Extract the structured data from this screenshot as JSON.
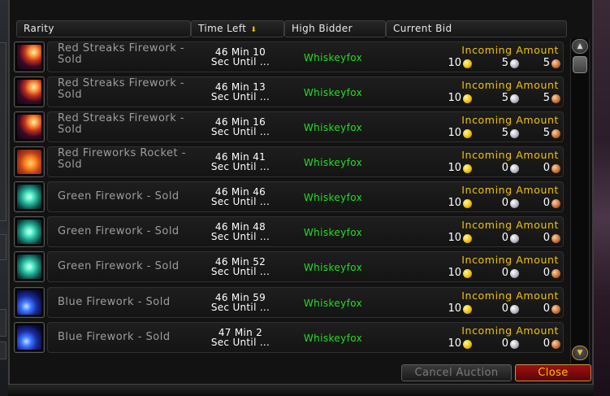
{
  "header": {
    "rarity": "Rarity",
    "time_left": "Time Left",
    "high_bidder": "High Bidder",
    "current_bid": "Current Bid"
  },
  "rows": [
    {
      "icon": "red-streaks-firework-icon",
      "name": "Red Streaks Firework - Sold",
      "time_left": "46 Min 10 Sec Until ...",
      "time_line1": "46 Min 10",
      "time_line2": "Sec Until ...",
      "bidder": "Whiskeyfox",
      "bid_label": "Incoming Amount",
      "gold": "10",
      "silver": "5",
      "copper": "5"
    },
    {
      "icon": "red-streaks-firework-icon",
      "name": "Red Streaks Firework - Sold",
      "time_left": "46 Min 13 Sec Until ...",
      "time_line1": "46 Min 13",
      "time_line2": "Sec Until ...",
      "bidder": "Whiskeyfox",
      "bid_label": "Incoming Amount",
      "gold": "10",
      "silver": "5",
      "copper": "5"
    },
    {
      "icon": "red-streaks-firework-icon",
      "name": "Red Streaks Firework - Sold",
      "time_left": "46 Min 16 Sec Until ...",
      "time_line1": "46 Min 16",
      "time_line2": "Sec Until ...",
      "bidder": "Whiskeyfox",
      "bid_label": "Incoming Amount",
      "gold": "10",
      "silver": "5",
      "copper": "5"
    },
    {
      "icon": "red-fireworks-rocket-icon",
      "name": "Red Fireworks Rocket - Sold",
      "time_left": "46 Min 41 Sec Until ...",
      "time_line1": "46 Min 41",
      "time_line2": "Sec Until ...",
      "bidder": "Whiskeyfox",
      "bid_label": "Incoming Amount",
      "gold": "10",
      "silver": "0",
      "copper": "0"
    },
    {
      "icon": "green-firework-icon",
      "name": "Green Firework - Sold",
      "time_left": "46 Min 46 Sec Until ...",
      "time_line1": "46 Min 46",
      "time_line2": "Sec Until ...",
      "bidder": "Whiskeyfox",
      "bid_label": "Incoming Amount",
      "gold": "10",
      "silver": "0",
      "copper": "0"
    },
    {
      "icon": "green-firework-icon",
      "name": "Green Firework - Sold",
      "time_left": "46 Min 48 Sec Until ...",
      "time_line1": "46 Min 48",
      "time_line2": "Sec Until ...",
      "bidder": "Whiskeyfox",
      "bid_label": "Incoming Amount",
      "gold": "10",
      "silver": "0",
      "copper": "0"
    },
    {
      "icon": "green-firework-icon",
      "name": "Green Firework - Sold",
      "time_left": "46 Min 52 Sec Until ...",
      "time_line1": "46 Min 52",
      "time_line2": "Sec Until ...",
      "bidder": "Whiskeyfox",
      "bid_label": "Incoming Amount",
      "gold": "10",
      "silver": "0",
      "copper": "0"
    },
    {
      "icon": "blue-firework-icon",
      "name": "Blue Firework - Sold",
      "time_left": "46 Min 59 Sec Until ...",
      "time_line1": "46 Min 59",
      "time_line2": "Sec Until ...",
      "bidder": "Whiskeyfox",
      "bid_label": "Incoming Amount",
      "gold": "10",
      "silver": "0",
      "copper": "0"
    },
    {
      "icon": "blue-firework-icon",
      "name": "Blue Firework - Sold",
      "time_left": "47 Min 2 Sec Until ...",
      "time_line1": "47 Min 2",
      "time_line2": "Sec Until ...",
      "bidder": "Whiskeyfox",
      "bid_label": "Incoming Amount",
      "gold": "10",
      "silver": "0",
      "copper": "0"
    }
  ],
  "buttons": {
    "cancel_auction": "Cancel Auction",
    "close": "Close"
  },
  "colors": {
    "item_name_sold": "#9d9d9d",
    "bidder": "#1ee01e",
    "incoming_label": "#f2c200",
    "time_text": "#ffffff"
  }
}
